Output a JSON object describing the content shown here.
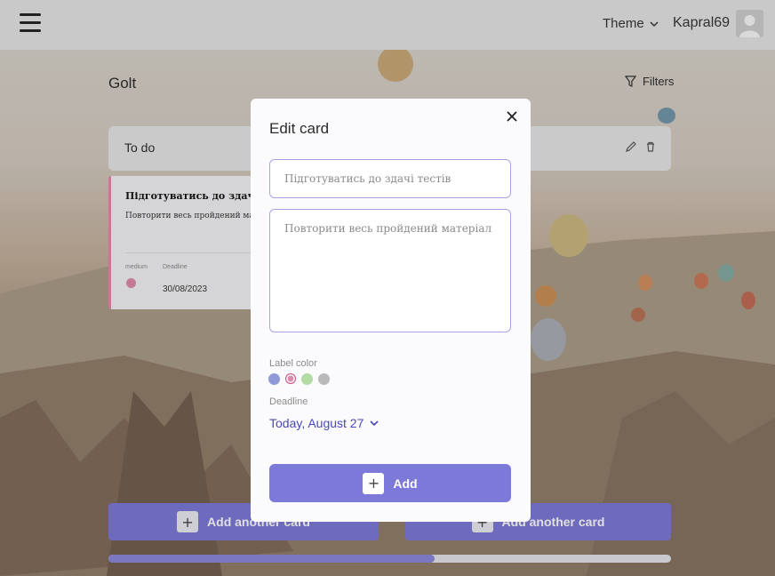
{
  "header": {
    "theme_label": "Theme",
    "username": "Kapral69"
  },
  "board": {
    "title": "Golt",
    "filters_label": "Filters",
    "columns": [
      {
        "title": "To do",
        "add_label": "Add another card",
        "cards": [
          {
            "title": "Підготуватись до здачі тес",
            "description": "Повторити весь пройдений мате",
            "priority_label": "medium",
            "deadline_label": "Deadline",
            "deadline": "30/08/2023",
            "color": "#e08aac"
          }
        ]
      },
      {
        "title": "",
        "add_label": "Add another card",
        "cards": []
      }
    ],
    "scroll_progress": 0.58
  },
  "modal": {
    "title": "Edit card",
    "title_placeholder": "Підготуватись до здачі тестів",
    "description_placeholder": "Повторити весь пройдений матеріал",
    "label_color_label": "Label color",
    "label_colors": [
      "#8f9ad6",
      "#e08aac",
      "#b3dba4",
      "#b9b9b9"
    ],
    "selected_color_index": 1,
    "deadline_label": "Deadline",
    "deadline_value": "Today, August 27",
    "add_label": "Add"
  },
  "colors": {
    "accent": "#7c79d9",
    "accent_dark": "#4a47b8",
    "input_border": "#a8a6e2"
  }
}
